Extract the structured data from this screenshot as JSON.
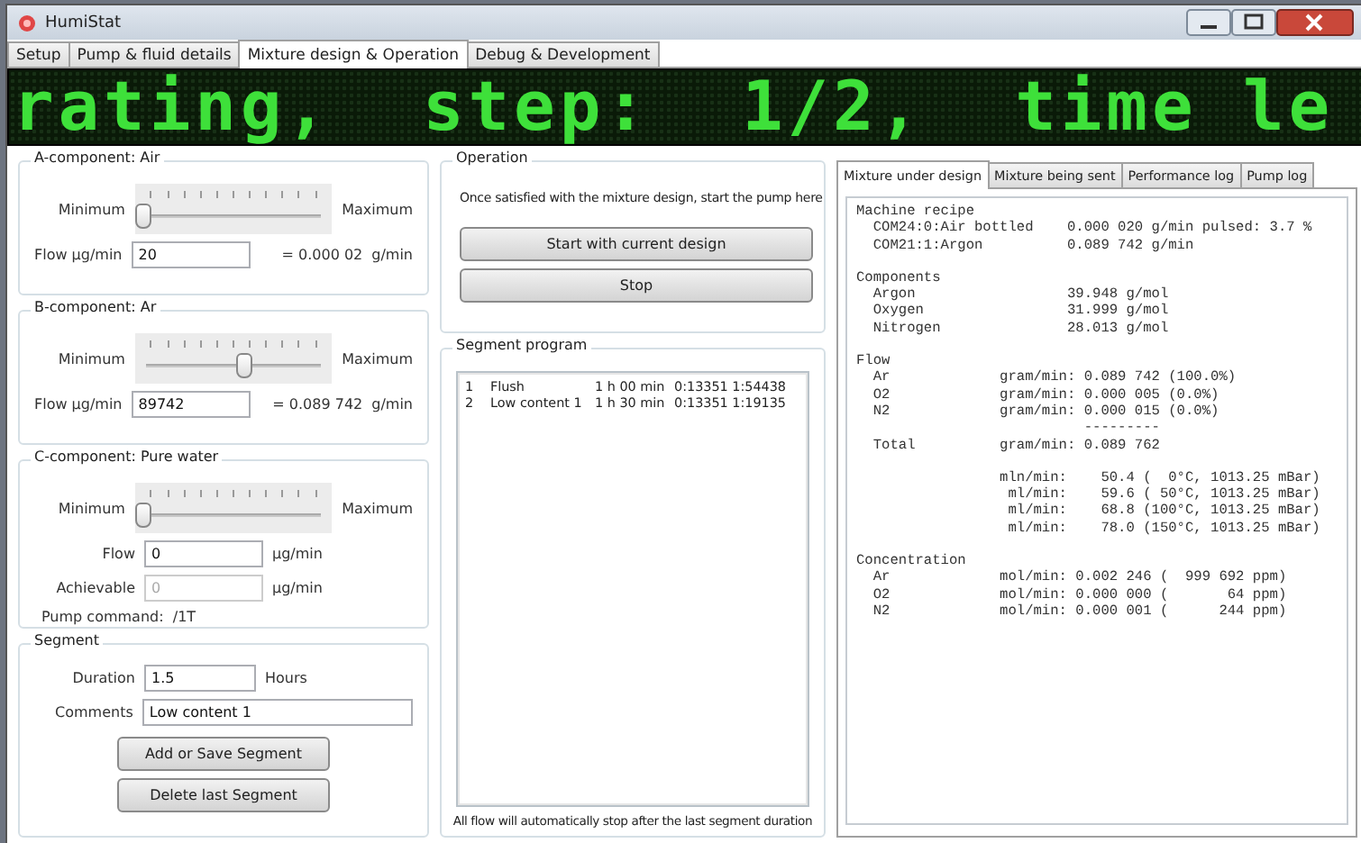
{
  "window": {
    "title": "HumiStat"
  },
  "tabs": [
    {
      "label": "Setup",
      "selected": false
    },
    {
      "label": "Pump & fluid details",
      "selected": false
    },
    {
      "label": "Mixture design & Operation",
      "selected": true
    },
    {
      "label": "Debug & Development",
      "selected": false
    }
  ],
  "led": {
    "text": "rating,  step:  1/2,  time le"
  },
  "a_component": {
    "title": "A-component: Air",
    "min_label": "Minimum",
    "max_label": "Maximum",
    "level": 0,
    "flow_label": "Flow µg/min",
    "flow_value": "20",
    "equals": "= 0.000 02",
    "unit": "g/min"
  },
  "b_component": {
    "title": "B-component: Ar",
    "min_label": "Minimum",
    "max_label": "Maximum",
    "level": 0.5,
    "flow_label": "Flow µg/min",
    "flow_value": "89742",
    "equals": "= 0.089 742",
    "unit": "g/min"
  },
  "c_component": {
    "title": "C-component: Pure water",
    "min_label": "Minimum",
    "max_label": "Maximum",
    "level": 0,
    "flow": {
      "label": "Flow",
      "value": "0",
      "unit": "µg/min",
      "disabled": false
    },
    "achievable": {
      "label": "Achievable",
      "value": "0",
      "unit": "µg/min",
      "disabled": true
    },
    "pump_command": "Pump command:  /1T"
  },
  "segment": {
    "title": "Segment",
    "duration_label": "Duration",
    "duration_value": "1.5",
    "duration_unit": "Hours",
    "comments_label": "Comments",
    "comments_value": "Low content 1",
    "buttons": [
      "Add or Save Segment",
      "Delete last Segment"
    ]
  },
  "operation": {
    "title": "Operation",
    "text": "Once satisfied with the mixture design, start the pump here",
    "buttons": [
      "Start with current design",
      "Stop"
    ]
  },
  "segment_program": {
    "title": "Segment program",
    "rows": [
      {
        "index": "1",
        "name": "Flush",
        "duration": "1 h 00 min",
        "values": "0:13351 1:54438"
      },
      {
        "index": "2",
        "name": "Low content 1",
        "duration": "1 h 30 min",
        "values": "0:13351 1:19135"
      }
    ],
    "footer": "All flow will automatically stop after the last segment duration"
  },
  "report_tabs": [
    {
      "label": "Mixture under design",
      "selected": true
    },
    {
      "label": "Mixture being sent",
      "selected": false
    },
    {
      "label": "Performance log",
      "selected": false
    },
    {
      "label": "Pump log",
      "selected": false
    }
  ],
  "report": [
    {
      "lines": [
        "Machine recipe",
        "  COM24:0:Air bottled    0.000 020 g/min pulsed: 3.7 %",
        "  COM21:1:Argon          0.089 742 g/min"
      ]
    },
    {
      "lines": [
        "Components",
        "  Argon                  39.948 g/mol",
        "  Oxygen                 31.999 g/mol",
        "  Nitrogen               28.013 g/mol"
      ]
    },
    {
      "lines": [
        "Flow",
        "  Ar             gram/min: 0.089 742 (100.0%)",
        "  O2             gram/min: 0.000 005 (0.0%)",
        "  N2             gram/min: 0.000 015 (0.0%)",
        "                           ---------",
        "  Total          gram/min: 0.089 762"
      ]
    },
    {
      "lines": [
        "                 mln/min:    50.4 (  0°C, 1013.25 mBar)",
        "                  ml/min:    59.6 ( 50°C, 1013.25 mBar)",
        "                  ml/min:    68.8 (100°C, 1013.25 mBar)",
        "                  ml/min:    78.0 (150°C, 1013.25 mBar)"
      ]
    },
    {
      "lines": [
        "Concentration",
        "  Ar             mol/min: 0.002 246 (  999 692 ppm)",
        "  O2             mol/min: 0.000 000 (       64 ppm)",
        "  N2             mol/min: 0.000 001 (      244 ppm)"
      ]
    }
  ]
}
